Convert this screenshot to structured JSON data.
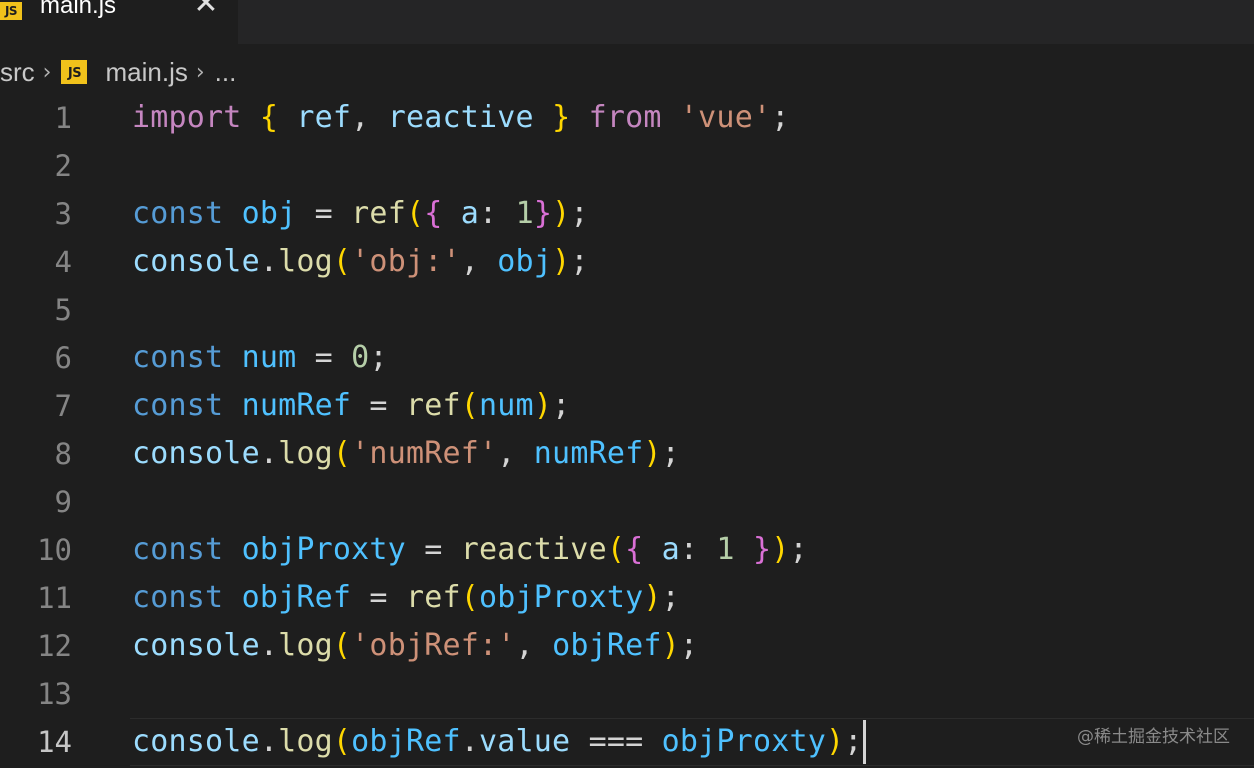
{
  "tab": {
    "icon_text": "JS",
    "title": "main.js",
    "close": "✕"
  },
  "breadcrumb": {
    "folder": "src",
    "file": "main.js",
    "more": "..."
  },
  "editor": {
    "current_line": 14,
    "lines": [
      {
        "number": "1",
        "text": "import { ref, reactive } from 'vue';"
      },
      {
        "number": "2",
        "text": ""
      },
      {
        "number": "3",
        "text": "const obj = ref({ a: 1});"
      },
      {
        "number": "4",
        "text": "console.log('obj:', obj);"
      },
      {
        "number": "5",
        "text": ""
      },
      {
        "number": "6",
        "text": "const num = 0;"
      },
      {
        "number": "7",
        "text": "const numRef = ref(num);"
      },
      {
        "number": "8",
        "text": "console.log('numRef', numRef);"
      },
      {
        "number": "9",
        "text": ""
      },
      {
        "number": "10",
        "text": "const objProxty = reactive({ a: 1 });"
      },
      {
        "number": "11",
        "text": "const objRef = ref(objProxty);"
      },
      {
        "number": "12",
        "text": "console.log('objRef:', objRef);"
      },
      {
        "number": "13",
        "text": ""
      },
      {
        "number": "14",
        "text": "console.log(objRef.value === objProxty);"
      }
    ]
  },
  "watermark": "@稀土掘金技术社区",
  "colors": {
    "background": "#1e1e1e",
    "keyword_import": "#c586c0",
    "keyword_decl": "#569cd6",
    "variable": "#9cdcfe",
    "function": "#dcdcaa",
    "string": "#ce9178",
    "number": "#b5cea8",
    "bracket_1": "#ffd700",
    "bracket_2": "#da70d6",
    "js_icon": "#f1c21b"
  }
}
